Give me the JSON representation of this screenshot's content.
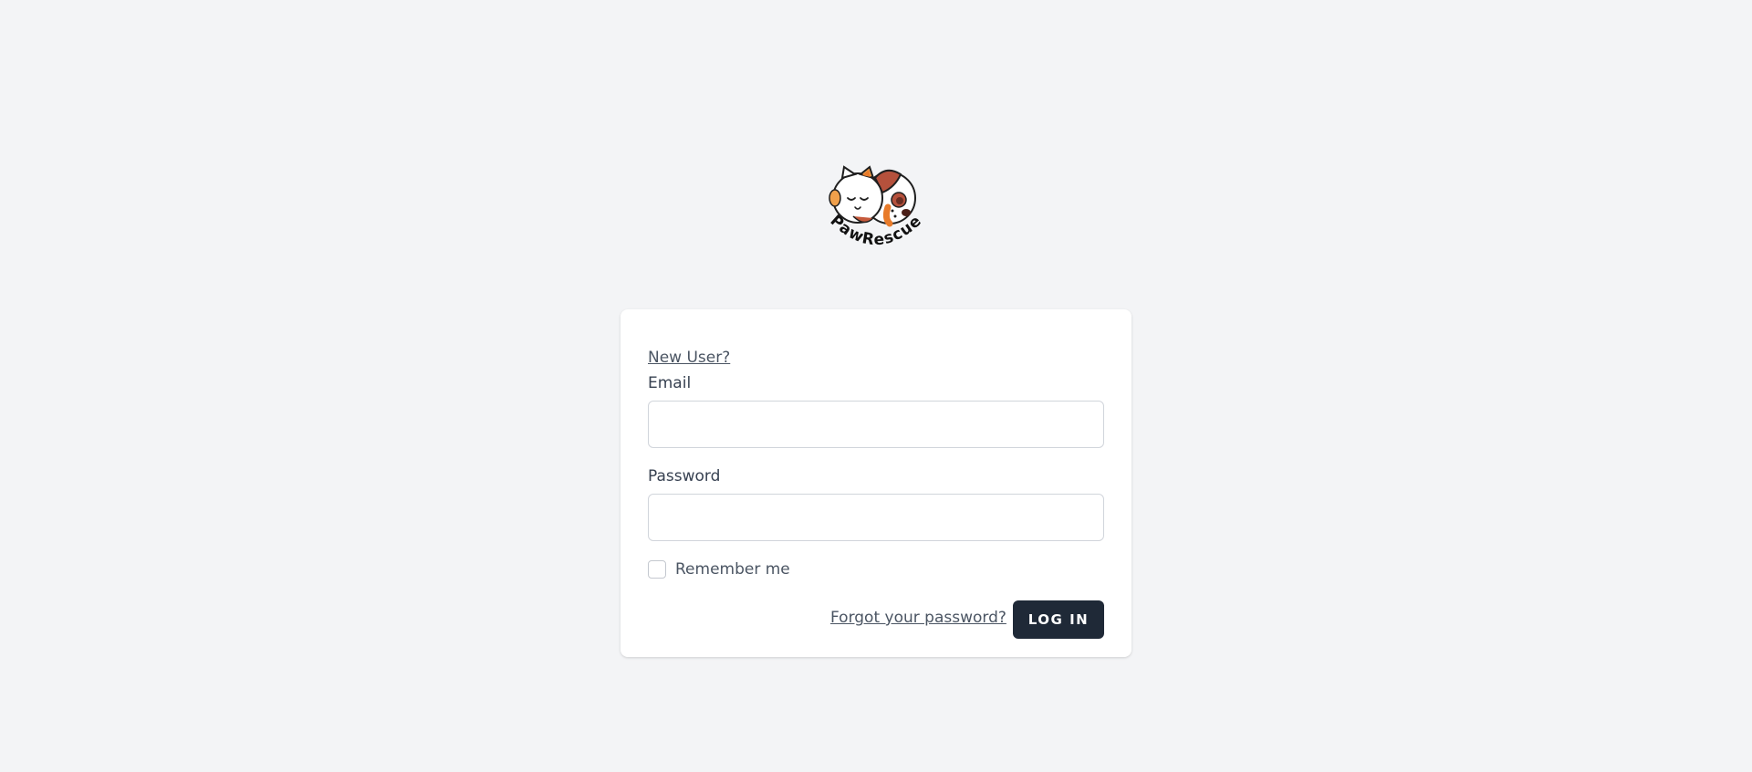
{
  "brand": {
    "logo_text": "PawRescue",
    "logo_icon": "cat-and-dog-heart-logo"
  },
  "login_form": {
    "new_user_link": "New User?",
    "email_label": "Email",
    "email_value": "",
    "password_label": "Password",
    "password_value": "",
    "remember_label": "Remember me",
    "remember_checked": false,
    "forgot_link": "Forgot your password?",
    "login_button": "LOG IN"
  },
  "colors": {
    "background": "#f3f4f6",
    "card": "#ffffff",
    "button": "#1f2937",
    "text": "#374151",
    "border": "#d1d5db"
  }
}
